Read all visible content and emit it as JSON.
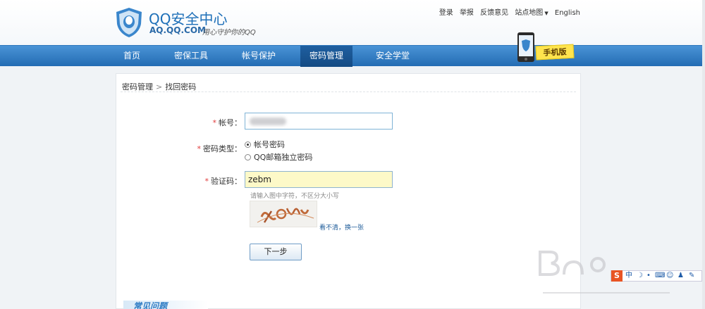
{
  "header": {
    "brand_title": "QQ安全中心",
    "brand_domain": "AQ.QQ.COM",
    "brand_slogan": "用心守护你的QQ",
    "links": {
      "login": "登录",
      "report": "举报",
      "feedback": "反馈意见",
      "sitemap": "站点地图",
      "english": "English"
    }
  },
  "nav": {
    "items": [
      {
        "label": "首页"
      },
      {
        "label": "密保工具"
      },
      {
        "label": "帐号保护"
      },
      {
        "label": "密码管理"
      },
      {
        "label": "安全学堂"
      }
    ],
    "active": "密码管理",
    "mobile_label": "手机版"
  },
  "breadcrumb": {
    "parent": "密码管理",
    "separator": ">",
    "current": "找回密码"
  },
  "form": {
    "account_label": "帐号：",
    "account_value": "",
    "type_label": "密码类型：",
    "type_options": [
      "帐号密码",
      "QQ邮箱独立密码"
    ],
    "type_selected": "帐号密码",
    "captcha_label": "验证码：",
    "captcha_value": "zebm",
    "captcha_hint": "请输入图中字符，不区分大小写",
    "captcha_refresh": "看不清，换一张",
    "submit": "下一步",
    "required_mark": "*"
  },
  "faq_title": "常见问题",
  "ime": {
    "chinese": "中"
  },
  "colors": {
    "nav_bg": "#236cb3",
    "brand": "#1d6fb8",
    "required": "#e03a3a",
    "link": "#1d5b99"
  }
}
